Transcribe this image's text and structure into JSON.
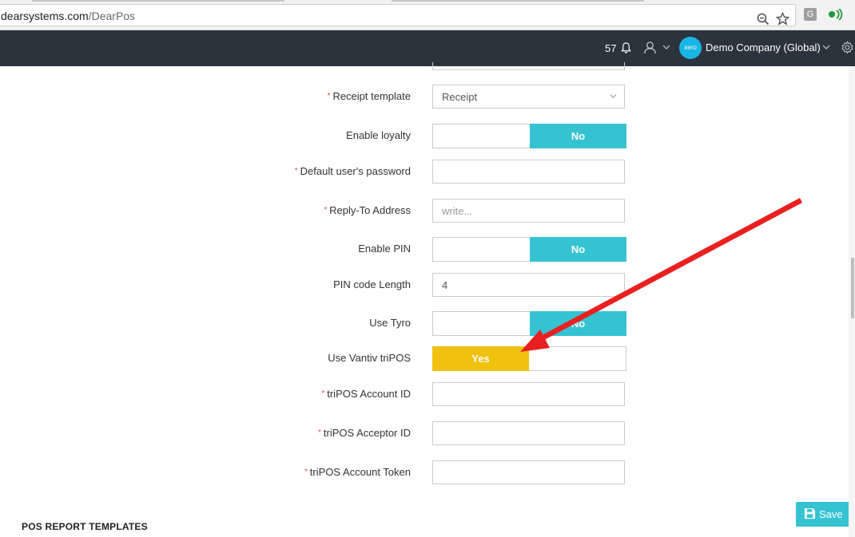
{
  "browser": {
    "url_domain": "dearsystems.com",
    "url_path": "/DearPos",
    "ext_g": "G"
  },
  "header": {
    "notification_count": "57",
    "company_name": "Demo Company (Global)",
    "logo_text": "xero"
  },
  "form": {
    "receipt_template": {
      "label": "Receipt template",
      "value": "Receipt"
    },
    "enable_loyalty": {
      "label": "Enable loyalty",
      "value": "No"
    },
    "default_user_password": {
      "label": "Default user's password",
      "value": ""
    },
    "reply_to_address": {
      "label": "Reply-To Address",
      "placeholder": "write..."
    },
    "enable_pin": {
      "label": "Enable PIN",
      "value": "No"
    },
    "pin_code_length": {
      "label": "PIN code Length",
      "value": "4"
    },
    "use_tyro": {
      "label": "Use Tyro",
      "value": "No"
    },
    "use_vantiv_tripos": {
      "label": "Use Vantiv triPOS",
      "value": "Yes"
    },
    "tripos_account_id": {
      "label": "triPOS Account ID",
      "value": ""
    },
    "tripos_acceptor_id": {
      "label": "triPOS Acceptor ID",
      "value": ""
    },
    "tripos_account_token": {
      "label": "triPOS Account Token",
      "value": ""
    },
    "required_marker": "*"
  },
  "section_title": "POS REPORT TEMPLATES",
  "save_label": "Save",
  "colors": {
    "header_bg": "#2b333c",
    "toggle_no": "#35c3d1",
    "toggle_yes": "#f0c20e",
    "required": "#d9534f",
    "arrow": "#e8201f"
  },
  "icons": [
    "zoom-icon",
    "star-icon",
    "bell-icon",
    "user-icon",
    "chevron-down-icon",
    "gear-icon",
    "save-icon",
    "arrow-annotation"
  ]
}
